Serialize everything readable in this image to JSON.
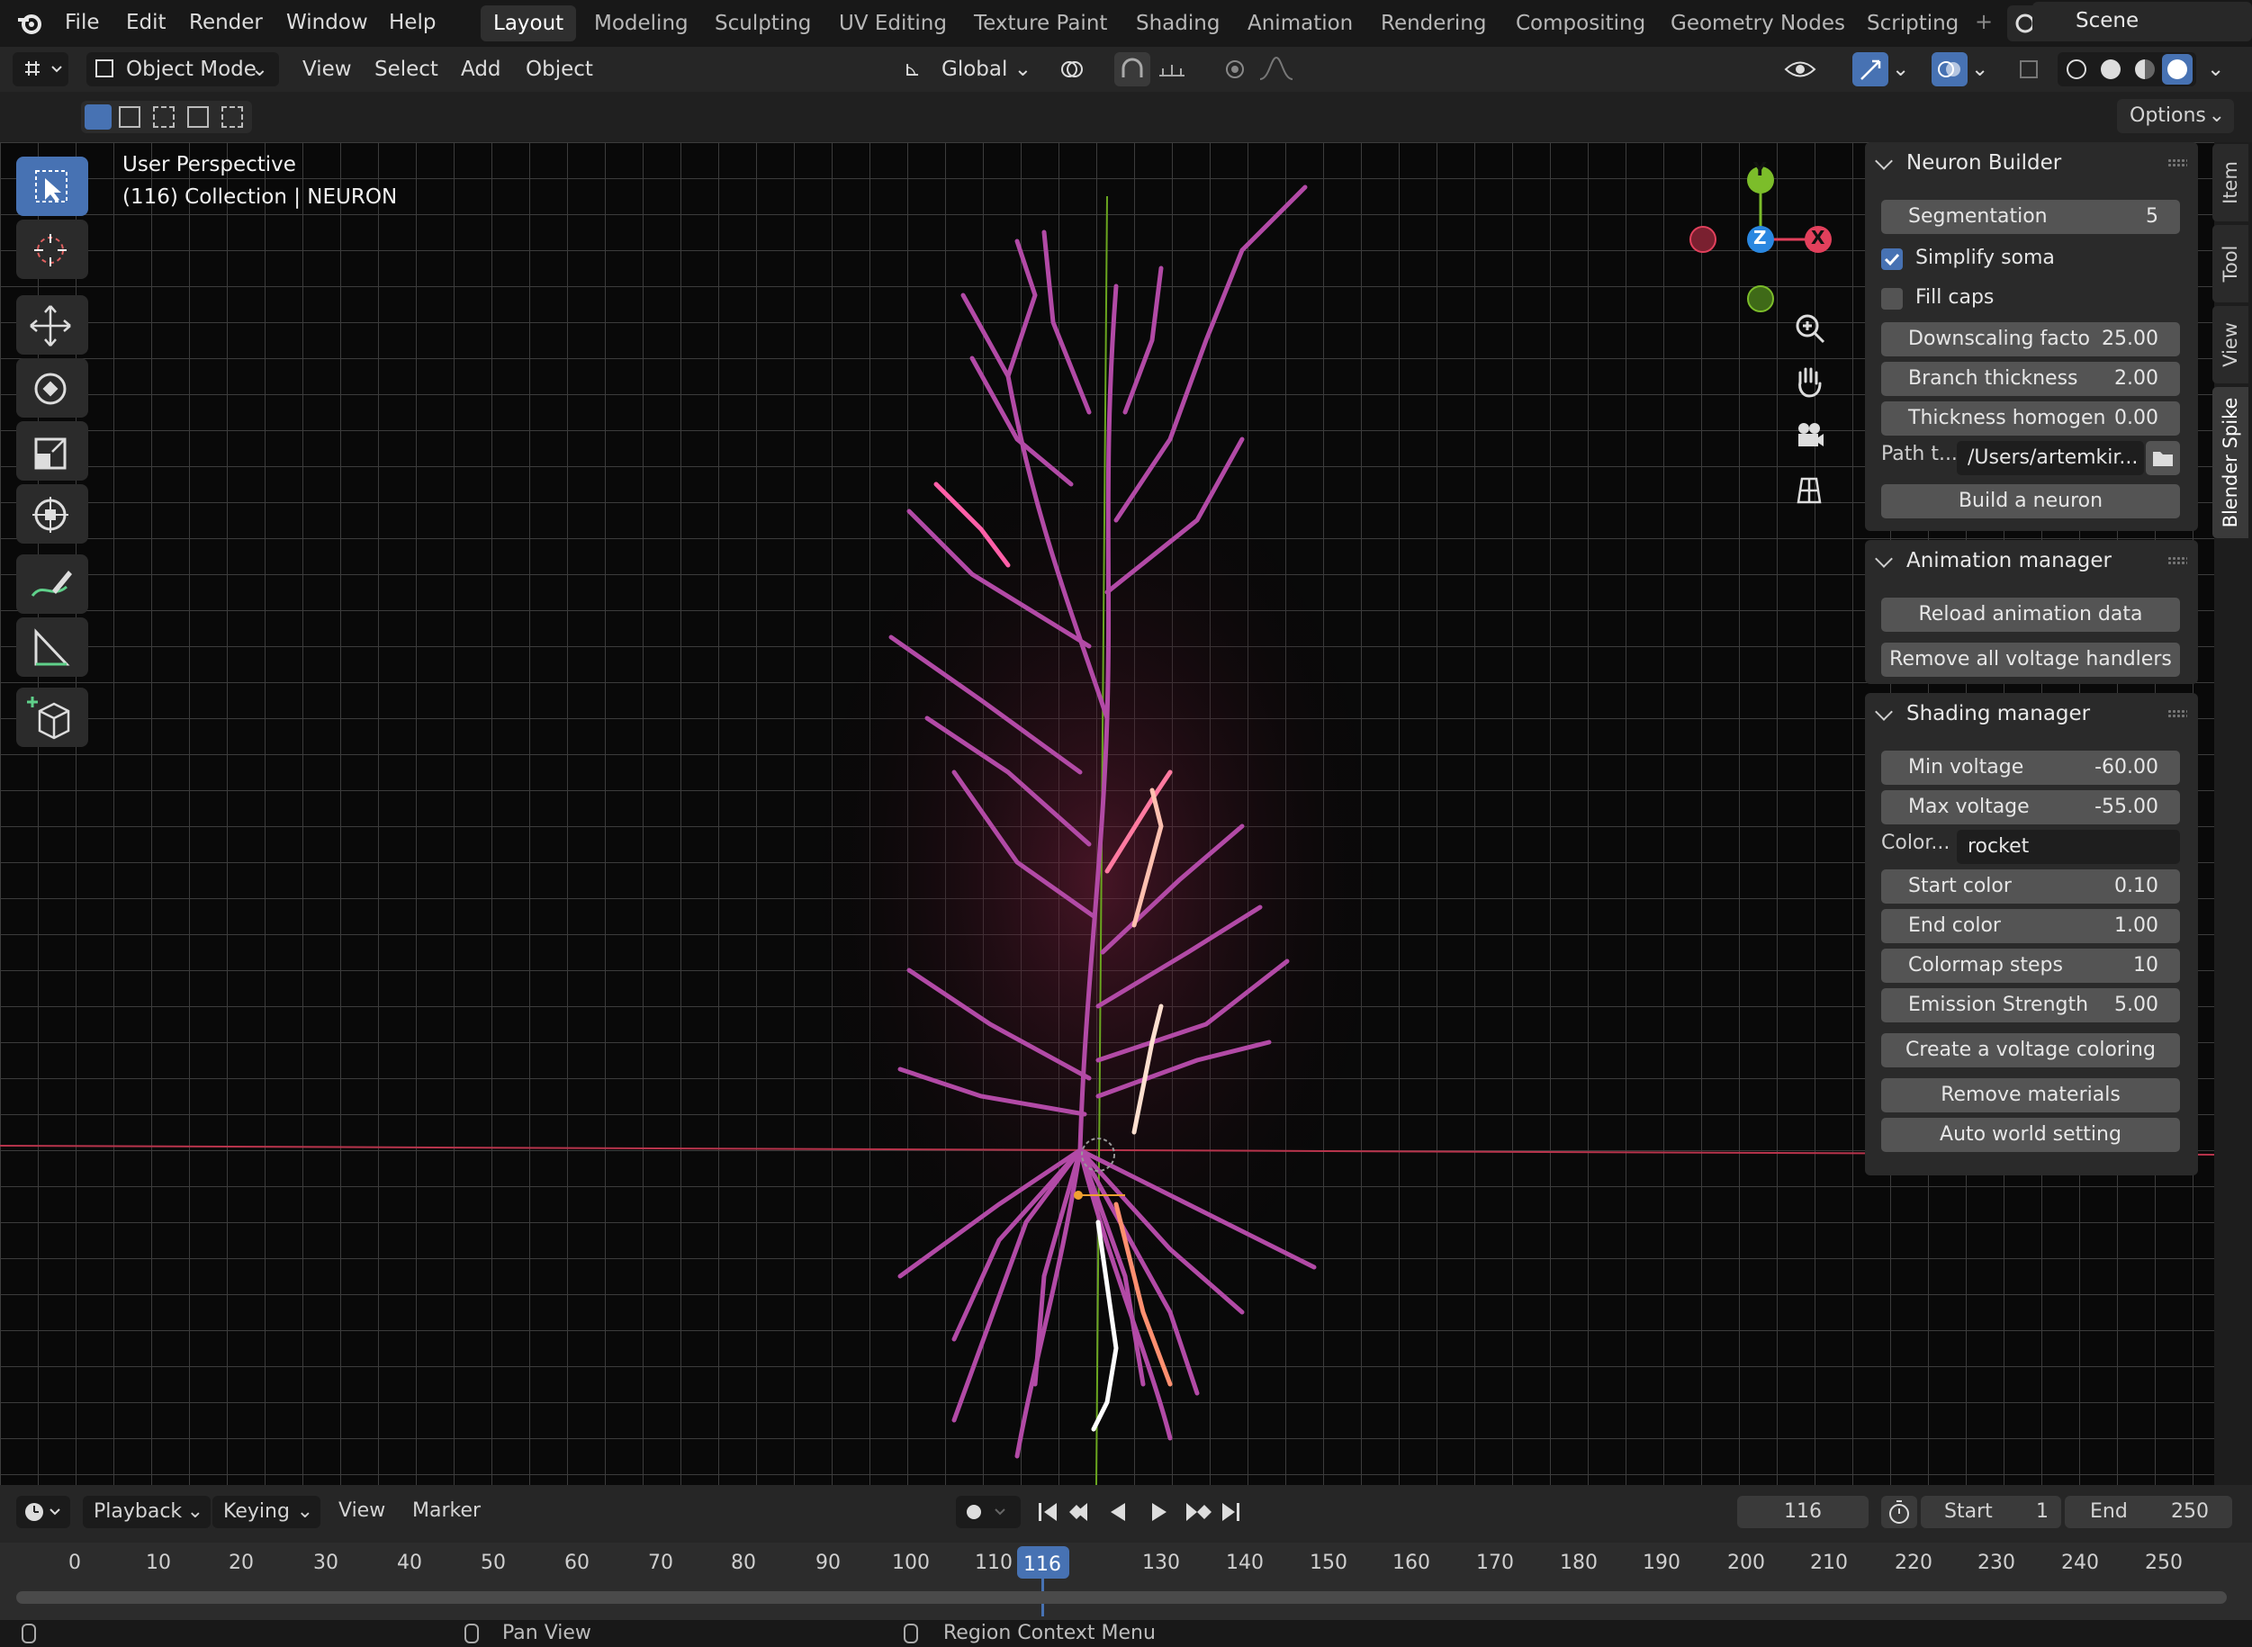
{
  "topbar": {
    "menus": [
      "File",
      "Edit",
      "Render",
      "Window",
      "Help"
    ],
    "workspaces": [
      "Layout",
      "Modeling",
      "Sculpting",
      "UV Editing",
      "Texture Paint",
      "Shading",
      "Animation",
      "Rendering",
      "Compositing",
      "Geometry Nodes",
      "Scripting"
    ],
    "active_workspace": "Layout",
    "scene": "Scene"
  },
  "header": {
    "mode": "Object Mode",
    "menus": [
      "View",
      "Select",
      "Add",
      "Object"
    ],
    "orientation": "Global"
  },
  "subheader": {
    "options": "Options"
  },
  "viewport": {
    "perspective": "User Perspective",
    "collection": "(116) Collection | NEURON",
    "gizmo": {
      "x": "X",
      "y": "Y",
      "z": "Z"
    }
  },
  "side_tabs": [
    "Item",
    "Tool",
    "View",
    "Blender Spike"
  ],
  "neuron_builder": {
    "title": "Neuron Builder",
    "segmentation_label": "Segmentation",
    "segmentation_value": "5",
    "simplify_soma": "Simplify soma",
    "simplify_soma_checked": true,
    "fill_caps": "Fill caps",
    "fill_caps_checked": false,
    "downscaling_label": "Downscaling facto",
    "downscaling_value": "25.00",
    "branch_label": "Branch thickness",
    "branch_value": "2.00",
    "thickness_label": "Thickness homogen",
    "thickness_value": "0.00",
    "path_label": "Path t...",
    "path_value": "/Users/artemkir...",
    "build_button": "Build a neuron"
  },
  "animation_manager": {
    "title": "Animation manager",
    "reload_button": "Reload animation data",
    "remove_button": "Remove all voltage handlers"
  },
  "shading_manager": {
    "title": "Shading manager",
    "min_label": "Min voltage",
    "min_value": "-60.00",
    "max_label": "Max voltage",
    "max_value": "-55.00",
    "color_label": "Color...",
    "color_value": "rocket",
    "start_label": "Start color",
    "start_value": "0.10",
    "end_label": "End color",
    "end_value": "1.00",
    "steps_label": "Colormap steps",
    "steps_value": "10",
    "emission_label": "Emission Strength",
    "emission_value": "5.00",
    "create_button": "Create a voltage coloring",
    "remove_button": "Remove materials",
    "auto_button": "Auto world setting"
  },
  "timeline": {
    "menus": [
      "Playback",
      "Keying",
      "View",
      "Marker"
    ],
    "current_frame": "116",
    "start_label": "Start",
    "start_value": "1",
    "end_label": "End",
    "end_value": "250",
    "ticks": [
      "0",
      "10",
      "20",
      "30",
      "40",
      "50",
      "60",
      "70",
      "80",
      "90",
      "100",
      "110",
      "116",
      "130",
      "140",
      "150",
      "160",
      "170",
      "180",
      "190",
      "200",
      "210",
      "220",
      "230",
      "240",
      "250"
    ]
  },
  "status": {
    "pan": "Pan View",
    "context": "Region Context Menu"
  },
  "colors": {
    "accent": "#4772b3",
    "neuron": "#c24fb0",
    "x_axis": "#e2405c",
    "y_axis": "#7cbd2a",
    "z_axis": "#2a87e0"
  }
}
